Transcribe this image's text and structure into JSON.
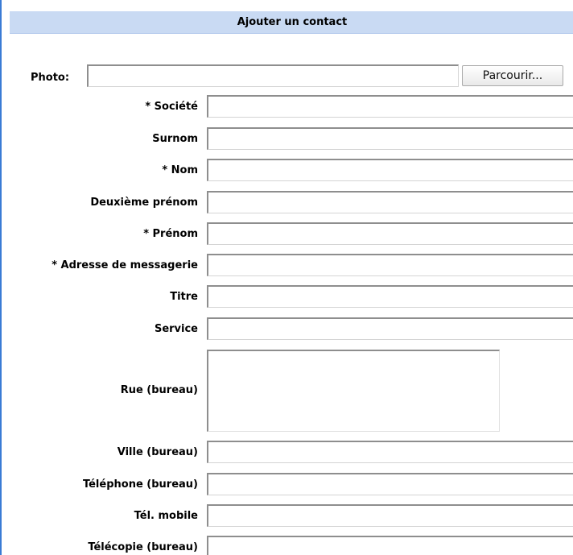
{
  "form": {
    "title": "Ajouter un contact",
    "photo_label": "Photo:",
    "browse_button": "Parcourir...",
    "fields": [
      {
        "label": "*  Société"
      },
      {
        "label": "Surnom"
      },
      {
        "label": "*  Nom"
      },
      {
        "label": "Deuxième prénom"
      },
      {
        "label": "*  Prénom"
      },
      {
        "label": "*  Adresse de messagerie"
      },
      {
        "label": "Titre"
      },
      {
        "label": "Service"
      },
      {
        "label": "Rue (bureau)"
      },
      {
        "label": "Ville (bureau)"
      },
      {
        "label": "Téléphone (bureau)"
      },
      {
        "label": "Tél. mobile"
      },
      {
        "label": "Télécopie (bureau)"
      }
    ]
  }
}
